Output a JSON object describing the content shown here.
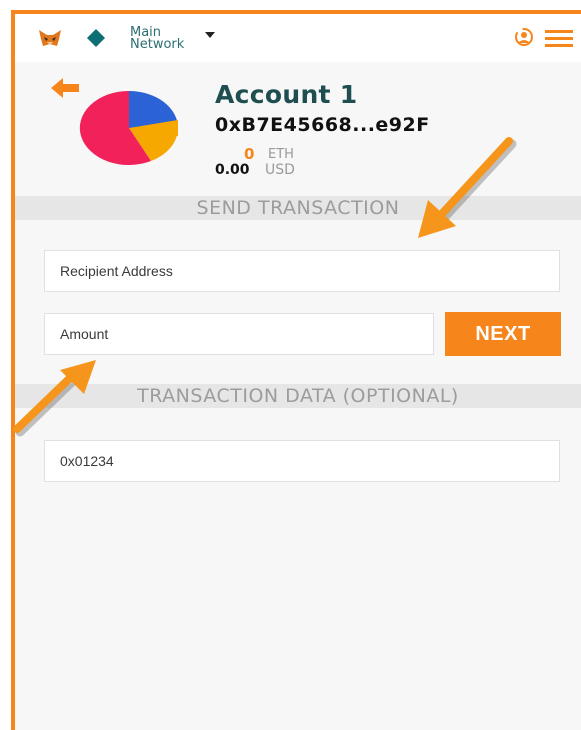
{
  "network": {
    "line1": "Main",
    "line2": "Network"
  },
  "account": {
    "name": "Account 1",
    "address": "0xB7E45668...e92F",
    "eth_amount": "0",
    "eth_label": "ETH",
    "usd_amount": "0.00",
    "usd_label": "USD"
  },
  "send": {
    "section_title": "SEND TRANSACTION",
    "recipient_placeholder": "Recipient Address",
    "amount_placeholder": "Amount",
    "next_label": "NEXT"
  },
  "data_section": {
    "title": "TRANSACTION DATA (OPTIONAL)",
    "value": "0x01234"
  },
  "colors": {
    "accent": "#f6851b",
    "network": "#2b6f73",
    "account_name": "#1f4e50"
  }
}
